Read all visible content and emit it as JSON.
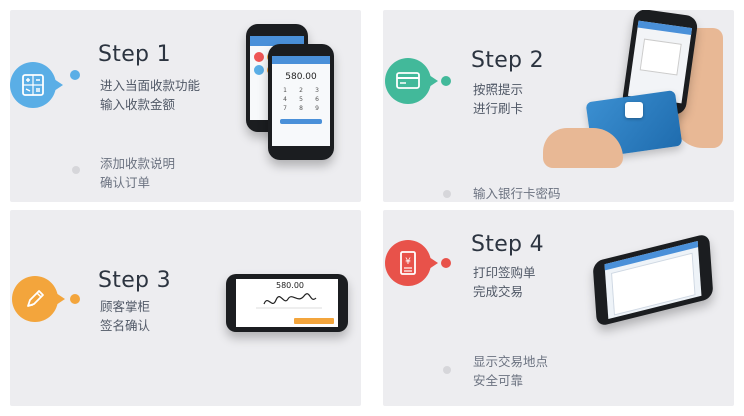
{
  "accent_colors": {
    "step1": "#5aaee6",
    "step2": "#42b99a",
    "step3": "#f3a53c",
    "step4": "#e8524a"
  },
  "steps": [
    {
      "title": "Step 1",
      "desc": "进入当面收款功能\n输入收款金额",
      "note": "添加收款说明\n确认订单",
      "icon": "calculator-icon",
      "screen_amount": "580.00"
    },
    {
      "title": "Step 2",
      "desc": "按照提示\n进行刷卡",
      "note": "输入银行卡密码",
      "icon": "card-reader-icon"
    },
    {
      "title": "Step 3",
      "desc": "顾客掌柜\n签名确认",
      "icon": "pen-icon",
      "screen_amount": "580.00"
    },
    {
      "title": "Step 4",
      "desc": "打印签购单\n完成交易",
      "note": "显示交易地点\n安全可靠",
      "icon": "receipt-icon"
    }
  ]
}
